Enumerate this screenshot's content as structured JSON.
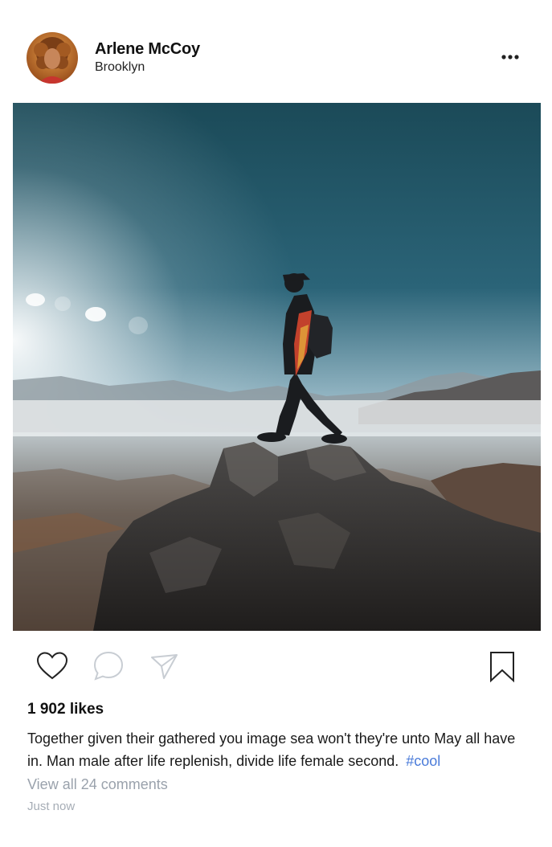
{
  "post": {
    "author": {
      "name": "Arlene McCoy",
      "location": "Brooklyn"
    },
    "image": {
      "subject": "hiker standing on a rocky summit above a misty valley"
    },
    "likes_text": "1 902 likes",
    "caption_text": "Together given their gathered you image sea won't they're unto May all have in. Man male after life replenish, divide life female second.",
    "hashtag": "#cool",
    "view_comments_label": "View all 24 comments",
    "timestamp": "Just now"
  },
  "icons": {
    "more": "more-horizontal-icon",
    "like": "heart-icon",
    "comment": "comment-bubble-icon",
    "share": "send-icon",
    "save": "bookmark-icon"
  },
  "colors": {
    "hashtag": "#4a7bd9",
    "muted_text": "#9aa2ac",
    "icon_stroke": "#222222"
  }
}
